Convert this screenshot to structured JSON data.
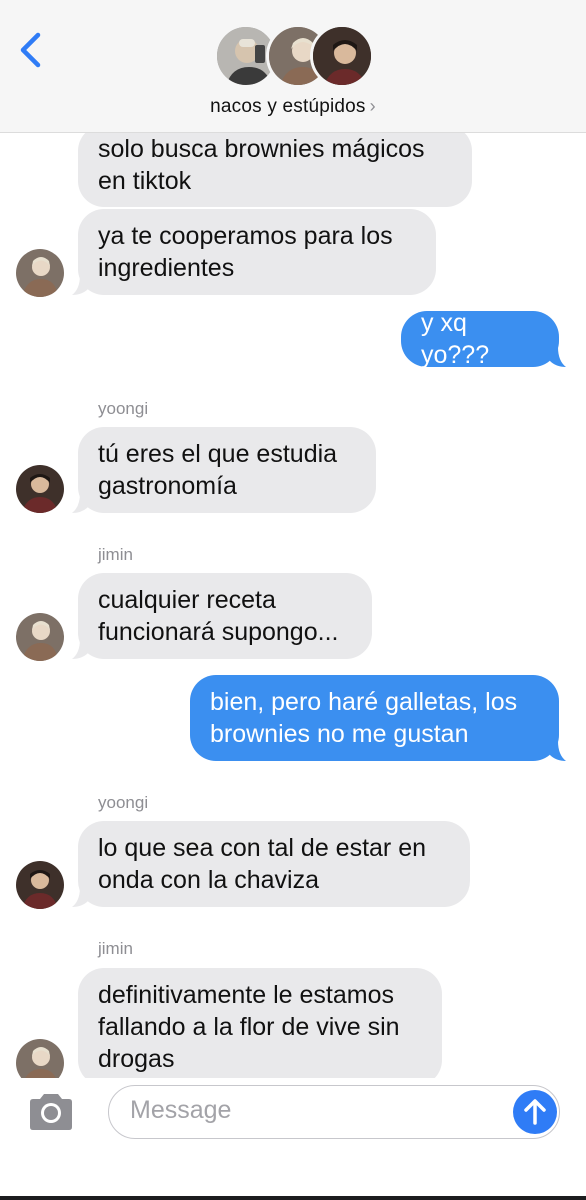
{
  "header": {
    "back_icon": "chevron-left-icon",
    "group_name": "nacos y estúpidos",
    "group_chevron": "›"
  },
  "messages": [
    {
      "direction": "in",
      "sender": "",
      "text_lines": [
        "solo busca brownies mágicos",
        "en tiktok"
      ]
    },
    {
      "direction": "in",
      "sender": "",
      "text_lines": [
        "ya te cooperamos para los",
        "ingredientes"
      ]
    },
    {
      "direction": "out",
      "text_lines": [
        "y xq yo???"
      ]
    },
    {
      "direction": "in",
      "sender": "yoongi",
      "text_lines": [
        "tú eres el que estudia",
        "gastronomía"
      ]
    },
    {
      "direction": "in",
      "sender": "jimin",
      "text_lines": [
        "cualquier receta",
        "funcionará supongo..."
      ]
    },
    {
      "direction": "out",
      "text_lines": [
        "bien, pero haré galletas, los",
        "brownies no me gustan"
      ]
    },
    {
      "direction": "in",
      "sender": "yoongi",
      "text_lines": [
        "lo que sea con tal de estar en",
        "onda con la chaviza"
      ]
    },
    {
      "direction": "in",
      "sender": "jimin",
      "text_lines": [
        "definitivamente le estamos",
        "fallando a la flor de vive sin",
        "drogas"
      ]
    }
  ],
  "input": {
    "placeholder": "Message",
    "camera_icon": "camera-icon",
    "send_icon": "send-arrow-icon"
  },
  "colors": {
    "outgoing": "#3b8ff0",
    "incoming": "#e9e9eb",
    "accent": "#2f7cf6"
  }
}
